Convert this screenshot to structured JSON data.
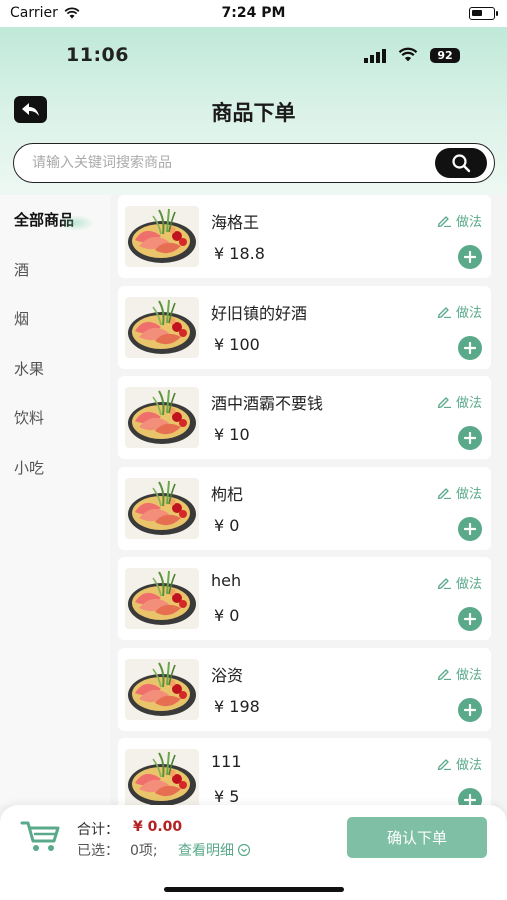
{
  "sim_status": {
    "carrier": "Carrier",
    "time": "7:24 PM"
  },
  "inner_status": {
    "time": "11:06",
    "battery": "92"
  },
  "header": {
    "title": "商品下单"
  },
  "search": {
    "placeholder": "请输入关键词搜索商品"
  },
  "sidebar": {
    "items": [
      {
        "label": "全部商品",
        "active": true
      },
      {
        "label": "酒"
      },
      {
        "label": "烟"
      },
      {
        "label": "水果"
      },
      {
        "label": "饮料"
      },
      {
        "label": "小吃"
      }
    ]
  },
  "products": [
    {
      "name": "海格王",
      "price": "¥ 18.8",
      "recipe": "做法"
    },
    {
      "name": "好旧镇的好酒",
      "price": "¥ 100",
      "recipe": "做法"
    },
    {
      "name": "酒中酒霸不要钱",
      "price": "¥ 10",
      "recipe": "做法"
    },
    {
      "name": "枸杞",
      "price": "¥ 0",
      "recipe": "做法"
    },
    {
      "name": "heh",
      "price": "¥ 0",
      "recipe": "做法"
    },
    {
      "name": "浴资",
      "price": "¥ 198",
      "recipe": "做法"
    },
    {
      "name": "111",
      "price": "¥ 5",
      "recipe": "做法"
    }
  ],
  "footer": {
    "total_label": "合计：",
    "total_value": "¥ 0.00",
    "selected_label": "已选：",
    "selected_value": "0项;",
    "detail_link": "查看明细",
    "confirm": "确认下单"
  },
  "colors": {
    "accent": "#5aa98a",
    "price_red": "#b22222",
    "confirm_bg": "#7fbfa6"
  }
}
